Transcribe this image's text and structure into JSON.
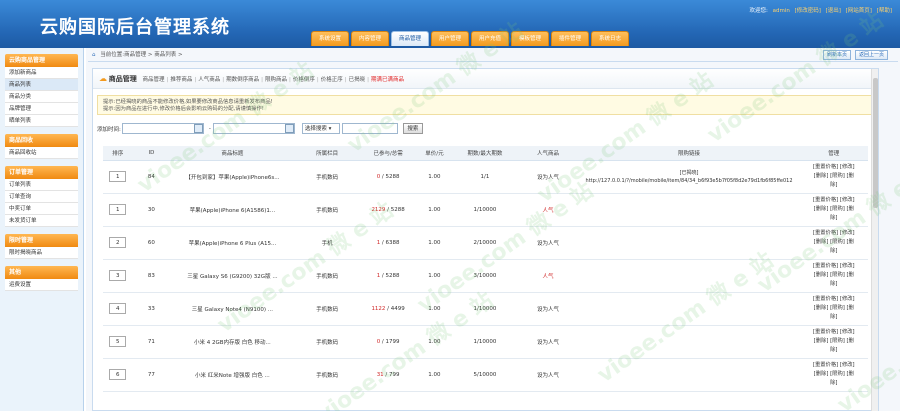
{
  "app": {
    "title": "云购国际后台管理系统"
  },
  "user_bar": {
    "prefix": "欢迎您:",
    "name": "admin",
    "links": [
      "[修改密码]",
      "[退出]",
      "[网站首页]",
      "[帮助]"
    ]
  },
  "top_nav": [
    "系统设置",
    "内容管理",
    "商品管理",
    "用户管理",
    "用户充值",
    "模板管理",
    "插件管理",
    "系统日志"
  ],
  "top_nav_active": 2,
  "sidebar": [
    {
      "title": "云购商品管理",
      "items": [
        "添加新商品",
        "商品列表",
        "商品分类",
        "品牌管理",
        "晒单列表"
      ],
      "active": 1
    },
    {
      "title": "商品回收",
      "items": [
        "商品回收站"
      ],
      "active": -1
    },
    {
      "title": "订单管理",
      "items": [
        "订单列表",
        "订单查询",
        "中奖订单",
        "未发货订单"
      ],
      "active": -1
    },
    {
      "title": "限时管理",
      "items": [
        "限时揭晓商品"
      ],
      "active": -1
    },
    {
      "title": "其他",
      "items": [
        "运费设置"
      ],
      "active": -1
    }
  ],
  "breadcrumb": {
    "home": "⌂",
    "text": "当前位置:商品管理 > 商品列表 >"
  },
  "crumb_buttons": [
    "刷新本页",
    "返回上一页"
  ],
  "panel": {
    "title": "商品管理",
    "tabs": [
      "商品管理",
      "推荐商品",
      "人气商品",
      "期数倒序商品",
      "限购商品",
      "价格倒序",
      "价格正序",
      "已揭晓",
      "期满已满商品"
    ],
    "red_tab": 8
  },
  "notice": {
    "line1": "提示:已经揭晓的商品不能修改价格,如果要修改商品信息请重新发布商品!",
    "line2": "提示:因为商品在进行中,修改价格后会影响云购码的分配,请谨慎操作!"
  },
  "search": {
    "label": "添加时间:",
    "select": "选择搜索 ▾",
    "button": "搜索"
  },
  "table": {
    "headers": [
      "排序",
      "ID",
      "商品标题",
      "所属栏目",
      "已参与/总需",
      "单价/元",
      "期数/最大期数",
      "人气商品",
      "限购链接",
      "管理"
    ],
    "rows": [
      {
        "sort": "1",
        "id": "84",
        "title": "【开包到家】苹果(Apple)iPhone6s...",
        "cat": "手机数码",
        "done": "0",
        "total": "5288",
        "price": "1.00",
        "period": "1/1",
        "hot": "设为人气",
        "hot_red": false,
        "link_label": "[已揭晓]",
        "url": "http://127.0.0.1/?/mobile/mobile/item/84/34_b6f93e5b7f05f8d2e79d1fb6f85ffe012",
        "manage": "[重置价格] [修改] [删除] [限购] [删除]"
      },
      {
        "sort": "1",
        "id": "30",
        "title": "苹果(Apple)iPhone 6(A1586)1...",
        "cat": "手机数码",
        "done": "2129",
        "total": "5288",
        "price": "1.00",
        "period": "1/10000",
        "hot": "人气",
        "hot_red": true,
        "link_label": "",
        "url": "",
        "manage": "[重置价格] [修改] [删除] [限购] [删除]"
      },
      {
        "sort": "2",
        "id": "60",
        "title": "苹果(Apple)iPhone 6 Plus (A15...",
        "cat": "手机",
        "done": "1",
        "total": "6388",
        "price": "1.00",
        "period": "2/10000",
        "hot": "设为人气",
        "hot_red": false,
        "link_label": "",
        "url": "",
        "manage": "[重置价格] [修改] [删除] [限购] [删除]"
      },
      {
        "sort": "3",
        "id": "83",
        "title": "三星 Galaxy S6 (G9200) 32G版 ...",
        "cat": "手机数码",
        "done": "1",
        "total": "5288",
        "price": "1.00",
        "period": "3/10000",
        "hot": "人气",
        "hot_red": true,
        "link_label": "",
        "url": "",
        "manage": "[重置价格] [修改] [删除] [限购] [删除]"
      },
      {
        "sort": "4",
        "id": "33",
        "title": "三星 Galaxy Note4 (N9100) ...",
        "cat": "手机数码",
        "done": "1122",
        "total": "4499",
        "price": "1.00",
        "period": "1/10000",
        "hot": "设为人气",
        "hot_red": false,
        "link_label": "",
        "url": "",
        "manage": "[重置价格] [修改] [删除] [限购] [删除]"
      },
      {
        "sort": "5",
        "id": "71",
        "title": "小米 4 2GB内存版 白色 移动...",
        "cat": "手机数码",
        "done": "0",
        "total": "1799",
        "price": "1.00",
        "period": "1/10000",
        "hot": "设为人气",
        "hot_red": false,
        "link_label": "",
        "url": "",
        "manage": "[重置价格] [修改] [删除] [限购] [删除]"
      },
      {
        "sort": "6",
        "id": "77",
        "title": "小米 红米Note 增强版 白色 ...",
        "cat": "手机数码",
        "done": "31",
        "total": "799",
        "price": "1.00",
        "period": "5/10000",
        "hot": "设为人气",
        "hot_red": false,
        "link_label": "",
        "url": "",
        "manage": "[重置价格] [修改] [删除] [限购] [删除]"
      }
    ]
  },
  "watermark": "vioee.com 微 e 站",
  "colors": {
    "header": "#2366b4",
    "accent": "#f39a1e",
    "red": "#d02828"
  }
}
